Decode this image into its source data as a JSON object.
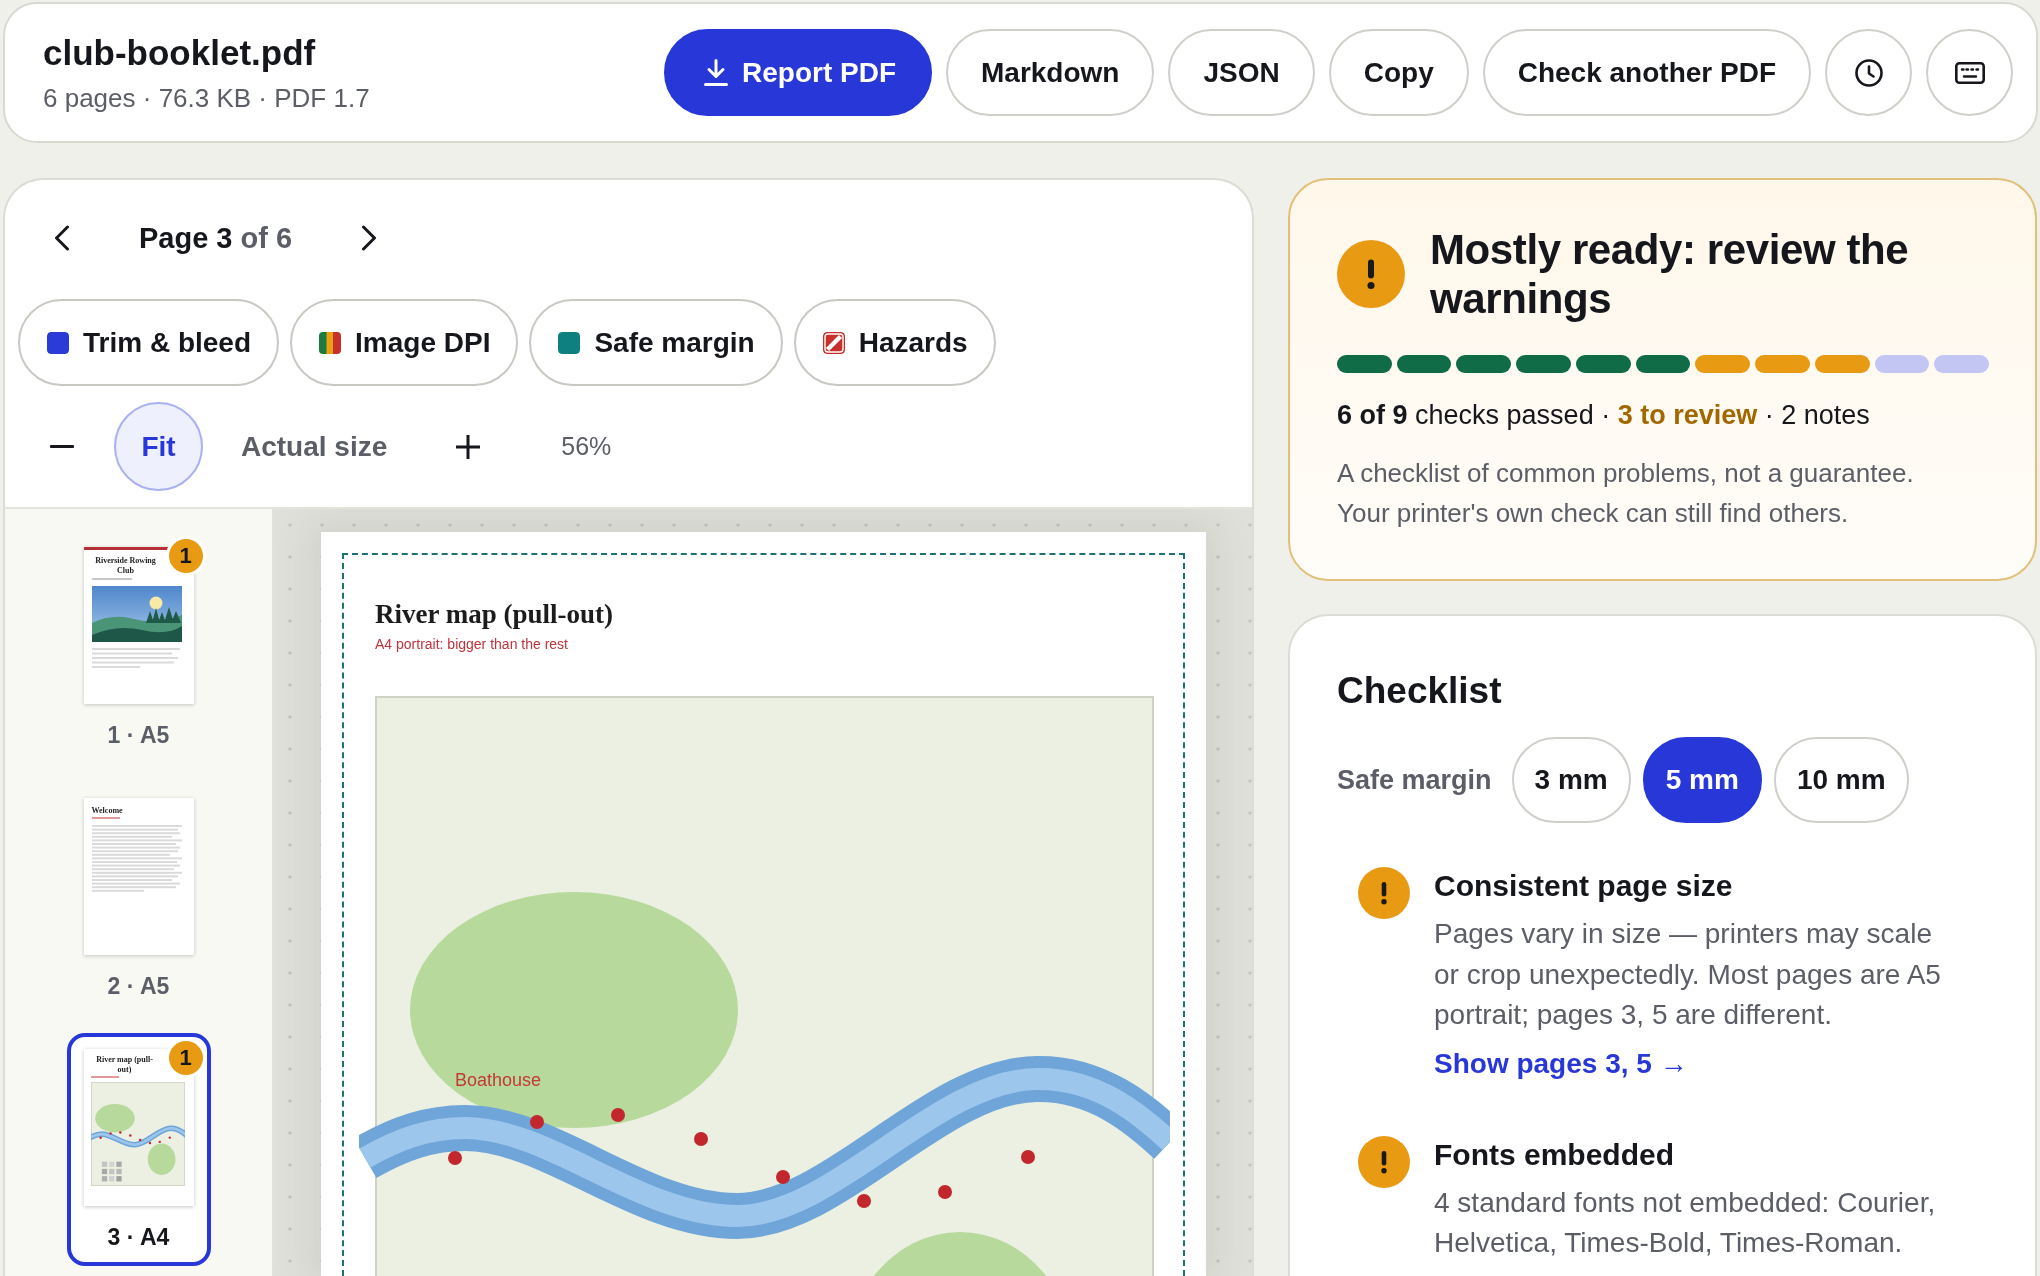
{
  "header": {
    "file_name": "club-booklet.pdf",
    "file_info": "6 pages · 76.3 KB · PDF 1.7",
    "actions": [
      {
        "label": "Report PDF",
        "kind": "primary"
      },
      {
        "label": "Markdown",
        "kind": "secondary"
      },
      {
        "label": "JSON",
        "kind": "secondary"
      },
      {
        "label": "Copy",
        "kind": "secondary"
      },
      {
        "label": "Check another PDF",
        "kind": "secondary"
      }
    ]
  },
  "viewer": {
    "pager": {
      "current": "Page 3",
      "total": "of 6"
    },
    "layers": [
      {
        "label": "Trim & bleed",
        "kind": "solid",
        "color": "#2a3bd8"
      },
      {
        "label": "Image DPI",
        "kind": "stripes"
      },
      {
        "label": "Safe margin",
        "kind": "solid",
        "color": "#0f8080"
      },
      {
        "label": "Hazards",
        "kind": "hatch"
      }
    ],
    "zoom": {
      "options": [
        {
          "label": "Fit",
          "selected": true
        },
        {
          "label": "Actual size",
          "selected": false
        }
      ],
      "percent": "56%"
    },
    "thumbnails": [
      {
        "label": "1 · A5",
        "selected": false,
        "badge": "1",
        "kind": "cover",
        "title": "Riverside Rowing Club"
      },
      {
        "label": "2 · A5",
        "selected": false,
        "kind": "text",
        "title": "Welcome"
      },
      {
        "label": "3 · A4",
        "selected": true,
        "badge": "1",
        "kind": "map",
        "title": "River map (pull-out)"
      }
    ],
    "page": {
      "title": "River map (pull-out)",
      "note": "A4 portrait: bigger than the rest",
      "map_label": "Boathouse"
    }
  },
  "summary": {
    "kind": "warning",
    "heading": "Mostly ready: review the warnings",
    "segments": [
      {
        "color": "#0f6c46"
      },
      {
        "color": "#0f6c46"
      },
      {
        "color": "#0f6c46"
      },
      {
        "color": "#0f6c46"
      },
      {
        "color": "#0f6c46"
      },
      {
        "color": "#0f6c46"
      },
      {
        "color": "#e89a13"
      },
      {
        "color": "#e89a13"
      },
      {
        "color": "#e89a13"
      },
      {
        "color": "#c3c6f3"
      },
      {
        "color": "#c3c6f3"
      }
    ],
    "counts": [
      {
        "text": "6 of 9",
        "kind": "strong"
      },
      {
        "text": "checks passed ·",
        "kind": "plain"
      },
      {
        "text": "3 to review",
        "kind": "warn"
      },
      {
        "text": "· 2 notes",
        "kind": "plain"
      }
    ],
    "disclaimer": "A checklist of common problems, not a guarantee. Your printer's own check can still find others."
  },
  "checklist": {
    "title": "Checklist",
    "margin": {
      "label": "Safe margin",
      "options": [
        {
          "label": "3 mm",
          "selected": false
        },
        {
          "label": "5 mm",
          "selected": true
        },
        {
          "label": "10 mm",
          "selected": false
        }
      ]
    },
    "items": [
      {
        "kind": "warning",
        "title": "Consistent page size",
        "description": "Pages vary in size — printers may scale or crop unexpectedly. Most pages are A5 portrait; pages 3, 5 are different.",
        "link": "Show pages 3, 5 →"
      },
      {
        "kind": "warning",
        "title": "Fonts embedded",
        "description": "4 standard fonts not embedded: Courier, Helvetica, Times-Bold, Times-Roman."
      }
    ]
  }
}
